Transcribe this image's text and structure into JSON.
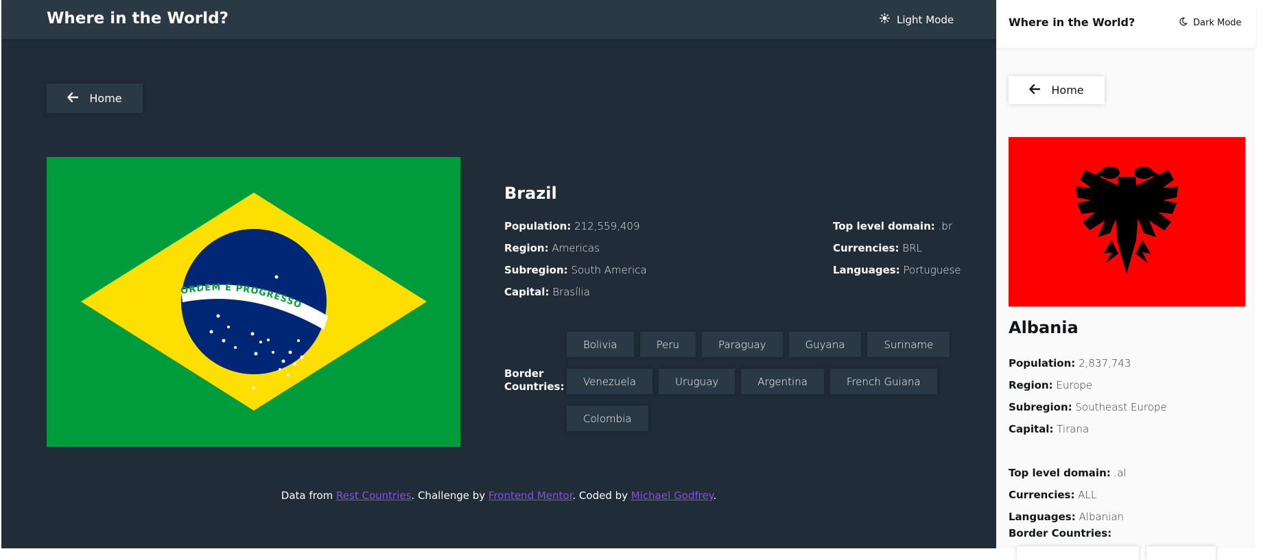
{
  "dark_panel": {
    "header": {
      "title": "Where in the World?",
      "mode_label": "Light Mode",
      "mode_icon": "sun-icon"
    },
    "back_button": {
      "label": "Home",
      "icon": "arrow-left-icon"
    },
    "country": {
      "name": "Brazil",
      "flag": "brazil-flag",
      "flag_motto": "ORDEM E PROGRESSO",
      "details_left": [
        {
          "label": "Population:",
          "value": "212,559,409"
        },
        {
          "label": "Region:",
          "value": "Americas"
        },
        {
          "label": "Subregion:",
          "value": "South America"
        },
        {
          "label": "Capital:",
          "value": "Brasília"
        }
      ],
      "details_right": [
        {
          "label": "Top level domain:",
          "value": ".br"
        },
        {
          "label": "Currencies:",
          "value": "BRL"
        },
        {
          "label": "Languages:",
          "value": "Portuguese"
        }
      ],
      "border_label": "Border Countries:",
      "borders": [
        [
          "Bolivia",
          "Peru",
          "Paraguay",
          "Guyana",
          "Suriname"
        ],
        [
          "Venezuela",
          "Uruguay",
          "Argentina",
          "French Guiana"
        ],
        [
          "Colombia"
        ]
      ]
    },
    "footer": {
      "prefix": "Data from ",
      "link1": "Rest Countries",
      "mid1": ". Challenge by ",
      "link2": "Frontend Mentor",
      "mid2": ". Coded by ",
      "link3": "Michael Godfrey",
      "suffix": "."
    },
    "colors": {
      "background": "#202c37",
      "elements": "#2b3945",
      "link": "#8a4fe0"
    }
  },
  "light_panel": {
    "header": {
      "title": "Where in the World?",
      "mode_label": "Dark Mode",
      "mode_icon": "moon-icon"
    },
    "back_button": {
      "label": "Home",
      "icon": "arrow-left-icon"
    },
    "country": {
      "name": "Albania",
      "flag": "albania-flag",
      "details": [
        {
          "label": "Population:",
          "value": "2,837,743"
        },
        {
          "label": "Region:",
          "value": "Europe"
        },
        {
          "label": "Subregion:",
          "value": "Southeast Europe"
        },
        {
          "label": "Capital:",
          "value": "Tirana"
        }
      ],
      "details2": [
        {
          "label": "Top level domain:",
          "value": ".al"
        },
        {
          "label": "Currencies:",
          "value": "ALL"
        },
        {
          "label": "Languages:",
          "value": "Albanian"
        }
      ],
      "border_label": "Border Countries:"
    },
    "colors": {
      "background": "#fafafa",
      "elements": "#ffffff",
      "text": "#111517"
    }
  }
}
